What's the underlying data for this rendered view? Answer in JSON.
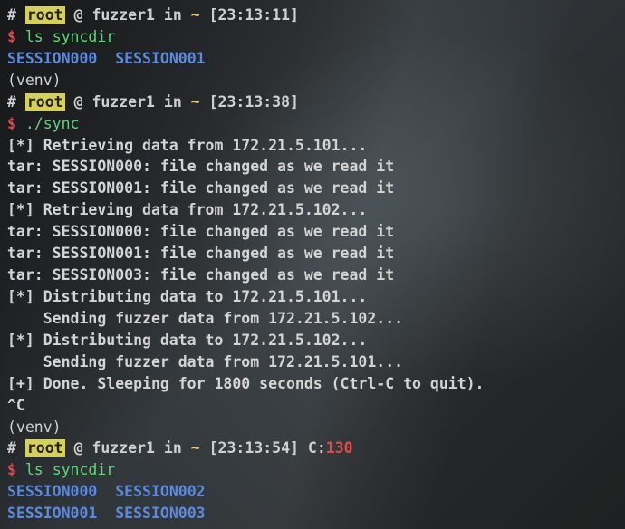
{
  "prompt1": {
    "hash": "#",
    "user": "root",
    "at": "@",
    "host": "fuzzer1",
    "in": "in",
    "path": "~",
    "time": "[23:13:11]"
  },
  "cmd1": {
    "dollar": "$",
    "cmd": "ls",
    "arg": "syncdir"
  },
  "out1": {
    "s0": "SESSION000",
    "s1": "SESSION001"
  },
  "venv1": "(venv)",
  "prompt2": {
    "hash": "#",
    "user": "root",
    "at": "@",
    "host": "fuzzer1",
    "in": "in",
    "path": "~",
    "time": "[23:13:38]"
  },
  "cmd2": {
    "dollar": "$",
    "cmd": "./sync"
  },
  "sync": {
    "r1": "[*] Retrieving data from 172.21.5.101...",
    "t1": "tar: SESSION000: file changed as we read it",
    "t2": "tar: SESSION001: file changed as we read it",
    "r2": "[*] Retrieving data from 172.21.5.102...",
    "t3": "tar: SESSION000: file changed as we read it",
    "t4": "tar: SESSION001: file changed as we read it",
    "t5": "tar: SESSION003: file changed as we read it",
    "d1": "[*] Distributing data to 172.21.5.101...",
    "s1": "    Sending fuzzer data from 172.21.5.102...",
    "d2": "[*] Distributing data to 172.21.5.102...",
    "s2": "    Sending fuzzer data from 172.21.5.101...",
    "done": "[+] Done. Sleeping for 1800 seconds (Ctrl-C to quit).",
    "ctrlc": "^C"
  },
  "venv2": "(venv)",
  "prompt3": {
    "hash": "#",
    "user": "root",
    "at": "@",
    "host": "fuzzer1",
    "in": "in",
    "path": "~",
    "time": "[23:13:54]",
    "c": "C:",
    "code": "130"
  },
  "cmd3": {
    "dollar": "$",
    "cmd": "ls",
    "arg": "syncdir"
  },
  "out2": {
    "r1a": "SESSION000",
    "r1b": "SESSION002",
    "r2a": "SESSION001",
    "r2b": "SESSION003"
  }
}
